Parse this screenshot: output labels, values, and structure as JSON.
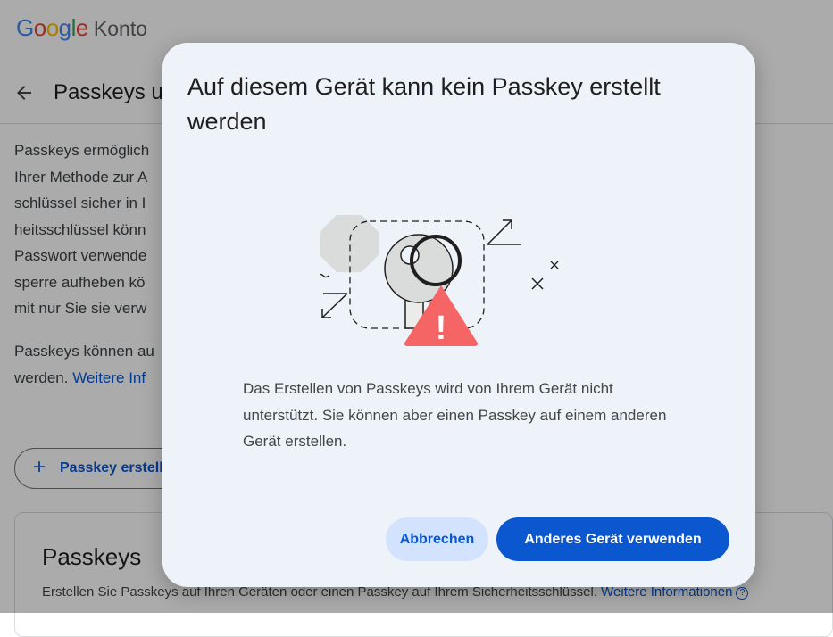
{
  "header": {
    "logo_parts": [
      "G",
      "o",
      "o",
      "g",
      "l",
      "e"
    ],
    "app_name": "Konto",
    "page_title": "Passkeys u"
  },
  "background": {
    "intro_lines": [
      "Passkeys ermöglich",
      "Ihrer Methode zur A",
      "schlüssel sicher in I",
      "heitsschlüssel könn",
      "Passwort verwende",
      "sperre aufheben kö",
      "mit nur Sie sie verw"
    ],
    "para2_line1": "Passkeys können au",
    "para2_line2_prefix": "werden.",
    "para2_link": "Weitere Inf",
    "add_button_plus": "+",
    "add_button_label": "Passkey erstell",
    "card_title": "Passkeys",
    "card_desc": "Erstellen Sie Passkeys auf Ihren Geräten oder einen Passkey auf Ihrem Sicherheitsschlüssel.",
    "card_link": "Weitere Informationen",
    "card_info_icon": "?"
  },
  "dialog": {
    "title": "Auf diesem Gerät kann kein Passkey erstellt werden",
    "body": "Das Erstellen von Passkeys wird von Ihrem Gerät nicht unterstützt. Sie können aber einen Passkey auf einem anderen Gerät erstellen.",
    "warning_mark": "!",
    "cancel_label": "Abbrechen",
    "primary_label": "Anderes Gerät verwenden"
  },
  "colors": {
    "accent": "#0b57d0",
    "tonal_button": "#d3e3fd",
    "dialog_bg": "#eef2f9",
    "warning": "#f56565",
    "icon_grey": "#dadcdb"
  },
  "icons": {
    "back": "arrow-back-icon",
    "illustration": "passkey-key-warning-illustration",
    "info": "info-circle-icon"
  }
}
